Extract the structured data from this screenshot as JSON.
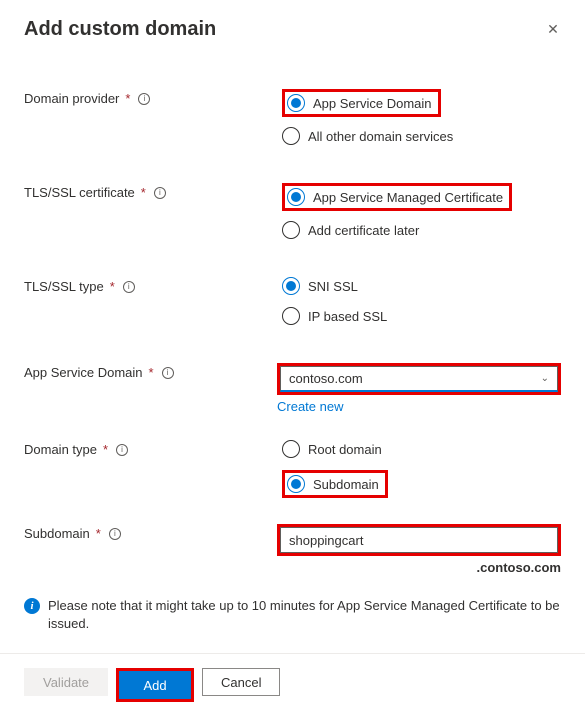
{
  "header": {
    "title": "Add custom domain"
  },
  "fields": {
    "domain_provider": {
      "label": "Domain provider",
      "options": {
        "app_service": "App Service Domain",
        "other": "All other domain services"
      }
    },
    "tls_cert": {
      "label": "TLS/SSL certificate",
      "options": {
        "managed": "App Service Managed Certificate",
        "later": "Add certificate later"
      }
    },
    "tls_type": {
      "label": "TLS/SSL type",
      "options": {
        "sni": "SNI SSL",
        "ip": "IP based SSL"
      }
    },
    "app_service_domain": {
      "label": "App Service Domain",
      "value": "contoso.com",
      "create_new": "Create new"
    },
    "domain_type": {
      "label": "Domain type",
      "options": {
        "root": "Root domain",
        "sub": "Subdomain"
      }
    },
    "subdomain": {
      "label": "Subdomain",
      "value": "shoppingcart",
      "suffix": ".contoso.com"
    }
  },
  "note": "Please note that it might take up to 10 minutes for App Service Managed Certificate to be issued.",
  "footer": {
    "validate": "Validate",
    "add": "Add",
    "cancel": "Cancel"
  }
}
